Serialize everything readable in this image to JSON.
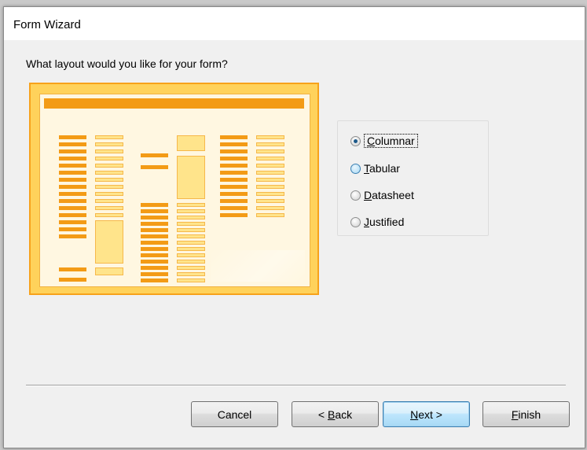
{
  "window": {
    "title": "Form Wizard"
  },
  "prompt": "What layout would you like for your form?",
  "layout_options": [
    {
      "label": "Columnar",
      "accel": "C",
      "rest": "olumnar",
      "selected": true
    },
    {
      "label": "Tabular",
      "accel": "T",
      "rest": "abular",
      "selected": false
    },
    {
      "label": "Datasheet",
      "accel": "D",
      "rest": "atasheet",
      "selected": false
    },
    {
      "label": "Justified",
      "accel": "J",
      "rest": "ustified",
      "selected": false
    }
  ],
  "buttons": {
    "cancel": {
      "label": "Cancel"
    },
    "back": {
      "pre": "< ",
      "accel": "B",
      "rest": "ack"
    },
    "next": {
      "accel": "N",
      "rest": "ext >"
    },
    "finish": {
      "accel": "F",
      "rest": "inish"
    }
  },
  "colors": {
    "accent": "#f39b16",
    "preview_border": "#f7a21b",
    "field_fill": "#ffe48b",
    "default_button": "#3c7fb1"
  }
}
